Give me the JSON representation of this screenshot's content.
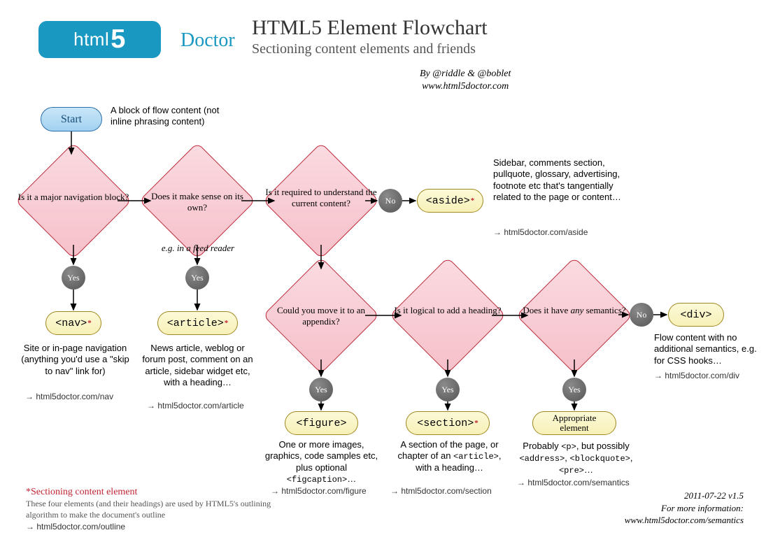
{
  "logo": {
    "html": "html",
    "five": "5",
    "doctor": "Doctor"
  },
  "title": "HTML5 Element Flowchart",
  "subtitle": "Sectioning content elements and friends",
  "byline": {
    "by": "By @riddle & @boblet",
    "url": "www.html5doctor.com"
  },
  "start": {
    "label": "Start",
    "note": "A block of flow content (not inline phrasing content)"
  },
  "d1": {
    "q": "Is it a major navigation block?",
    "yes": "Yes",
    "ans": "<nav>",
    "desc": "Site or in-page navigation (anything you'd use a \"skip to nav\" link for)",
    "link": "html5doctor.com/nav"
  },
  "d2": {
    "q": "Does it make sense on its own?",
    "note": "e.g. in a feed reader",
    "yes": "Yes",
    "ans": "<article>",
    "desc": "News article, weblog or forum post, comment on an article, sidebar widget etc, with a heading…",
    "link": "html5doctor.com/article"
  },
  "d3": {
    "q": "Is it required to understand the current content?",
    "no": "No",
    "ans": "<aside>",
    "desc": "Sidebar, comments section, pullquote, glossary, advertising, footnote etc that's tangentially related to the page or content…",
    "link": "html5doctor.com/aside"
  },
  "d4": {
    "q": "Could you move it to an appendix?",
    "yes": "Yes",
    "ans": "<figure>",
    "desc": "One or more images, graphics, code samples etc, plus optional <figcaption>…",
    "link": "html5doctor.com/figure"
  },
  "d5": {
    "q": "Is it logical to add a heading?",
    "yes": "Yes",
    "ans": "<section>",
    "desc": "A section of the page, or chapter of an <article>, with a heading…",
    "link": "html5doctor.com/section"
  },
  "d6": {
    "q": "Does it have any semantics?",
    "yes": "Yes",
    "no": "No",
    "ans_yes": "Appropriate element",
    "ans_no": "<div>",
    "desc_yes": "Probably <p>, but possibly <address>, <blockquote>, <pre>…",
    "desc_no": "Flow content with no additional semantics, e.g. for CSS hooks…",
    "link_yes": "html5doctor.com/semantics",
    "link_no": "html5doctor.com/div"
  },
  "footnote": {
    "hdr": "*Sectioning content element",
    "body": "These four elements (and their headings) are used by HTML5's outlining algorithm to make the document's outline",
    "link": "html5doctor.com/outline"
  },
  "footer": {
    "date": "2011-07-22 v1.5",
    "more": "For more information:",
    "url": "www.html5doctor.com/semantics"
  }
}
